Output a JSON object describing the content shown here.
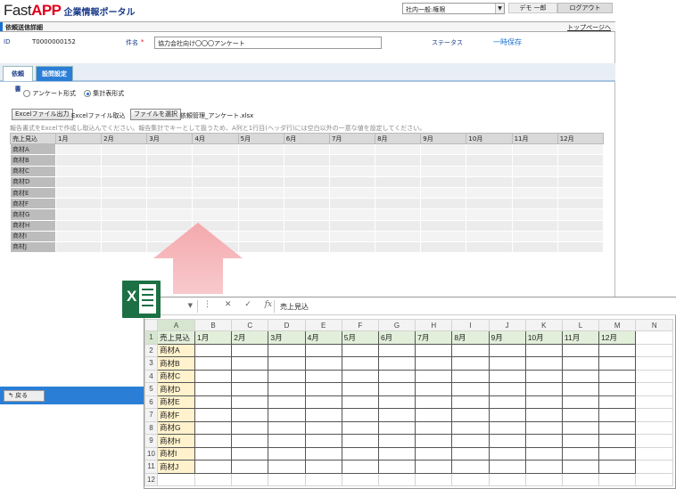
{
  "app": {
    "logo_fast": "Fast",
    "logo_app": "APP",
    "logo_portal": "企業情報ポータル",
    "role_select": "社内一般:権限",
    "user": "デモ 一郎",
    "logout": "ログアウト",
    "page_title": "依頼送信詳細",
    "top_link": "トップページへ"
  },
  "info": {
    "id_label": "ID",
    "id_value": "T0000000152",
    "subject_label": "件名",
    "required_mark": "*",
    "subject_value": "協力会社向け〇〇〇アンケート",
    "status_label": "ステータス",
    "status_value": "一時保存"
  },
  "tabs": [
    {
      "label": "依頼書"
    },
    {
      "label": "設問設定"
    }
  ],
  "form": {
    "radio_survey": "アンケート形式",
    "radio_table": "集計表形式",
    "excel_output_btn": "Excelファイル出力",
    "excel_import_label": "Excelファイル取込",
    "choose_file_btn": "ファイルを選択",
    "file_name": "依頼管理_アンケート.xlsx",
    "note": "報告書式をExcelで作成し取込んでください。報告集計でキーとして扱うため、A列と1行目(ヘッダ行)には空白以外の一意な値を設定してください。"
  },
  "grid": {
    "corner": "売上見込",
    "months": [
      "1月",
      "2月",
      "3月",
      "4月",
      "5月",
      "6月",
      "7月",
      "8月",
      "9月",
      "10月",
      "11月",
      "12月"
    ],
    "items": [
      "商材A",
      "商材B",
      "商材C",
      "商材D",
      "商材E",
      "商材F",
      "商材G",
      "商材H",
      "商材I",
      "商材J"
    ]
  },
  "footer": {
    "back_btn": "戻る"
  },
  "excel": {
    "namebox": "",
    "formula_value": "売上見込",
    "col_letters": [
      "A",
      "B",
      "C",
      "D",
      "E",
      "F",
      "G",
      "H",
      "I",
      "J",
      "K",
      "L",
      "M",
      "N"
    ],
    "row_numbers": [
      "1",
      "2",
      "3",
      "4",
      "5",
      "6",
      "7",
      "8",
      "9",
      "10",
      "11",
      "12"
    ],
    "header_corner": "売上見込",
    "months": [
      "1月",
      "2月",
      "3月",
      "4月",
      "5月",
      "6月",
      "7月",
      "8月",
      "9月",
      "10月",
      "11月",
      "12月"
    ],
    "items": [
      "商材A",
      "商材B",
      "商材C",
      "商材D",
      "商材E",
      "商材F",
      "商材G",
      "商材H",
      "商材I",
      "商材J"
    ]
  },
  "colors": {
    "accent_blue": "#2a7ed6",
    "brand_red": "#e2001a",
    "excel_green": "#1d7044",
    "arrow_pink": "#f4a9ad"
  }
}
